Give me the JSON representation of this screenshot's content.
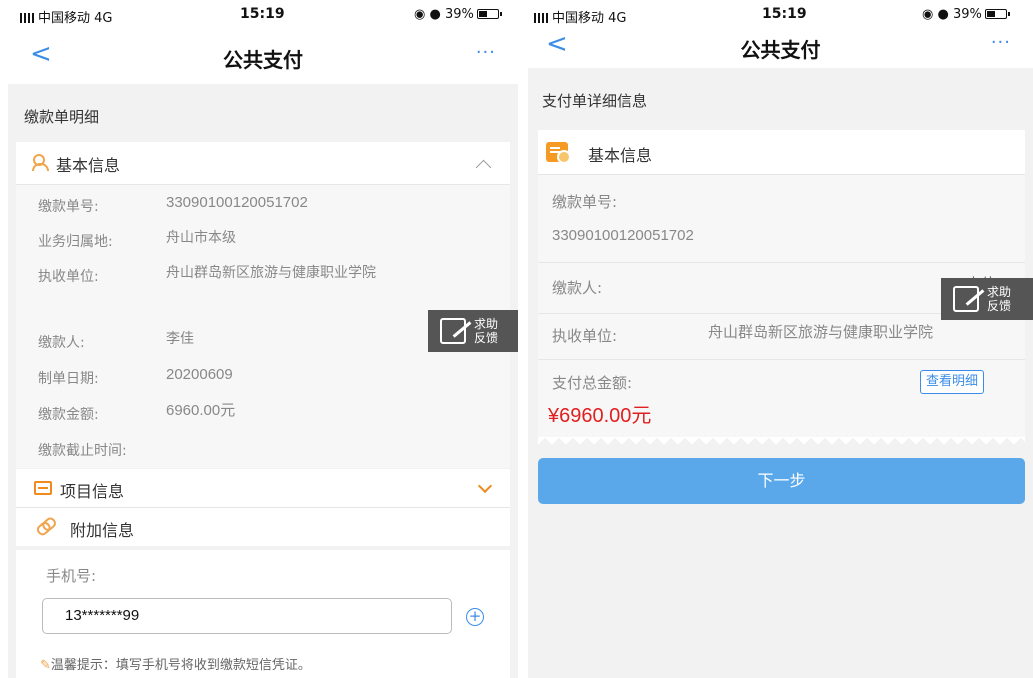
{
  "left": {
    "status": {
      "carrier": "中国移动 4G",
      "time": "15:19",
      "battery": "39%"
    },
    "nav": {
      "back": "<",
      "title": "公共支付",
      "more": "···"
    },
    "section_title": "缴款单明细",
    "basic": {
      "title": "基本信息",
      "rows": [
        {
          "label": "缴款单号:",
          "value": "33090100120051702"
        },
        {
          "label": "业务归属地:",
          "value": "舟山市本级"
        },
        {
          "label": "执收单位:",
          "value": "舟山群岛新区旅游与健康职业学院"
        },
        {
          "label": "缴款人:",
          "value": "李佳"
        },
        {
          "label": "制单日期:",
          "value": "20200609"
        },
        {
          "label": "缴款金额:",
          "value": "6960.00元"
        },
        {
          "label": "缴款截止时间:",
          "value": ""
        }
      ]
    },
    "project_title": "项目信息",
    "extra_title": "附加信息",
    "phone": {
      "label": "手机号:",
      "value": "13*******99"
    },
    "tip": "温馨提示：填写手机号将收到缴款短信凭证。",
    "help": "求助反馈"
  },
  "right": {
    "status": {
      "carrier": "中国移动 4G",
      "time": "15:19",
      "battery": "39%"
    },
    "nav": {
      "back": "<",
      "title": "公共支付",
      "more": "···"
    },
    "section_title": "支付单详细信息",
    "basic_title": "基本信息",
    "bill_no_label": "缴款单号:",
    "bill_no_value": "33090100120051702",
    "payer_label": "缴款人:",
    "payer_value": "李佳",
    "collector_label": "执收单位:",
    "collector_value": "舟山群岛新区旅游与健康职业学院",
    "total_label": "支付总金额:",
    "view_detail": "查看明细",
    "amount": "¥6960.00元",
    "next": "下一步",
    "help": "求助反馈"
  },
  "colors": {
    "accent": "#3b8de8",
    "amount_red": "#e02020",
    "button_blue": "#5aa8ea",
    "icon_orange": "#f08a1c"
  }
}
